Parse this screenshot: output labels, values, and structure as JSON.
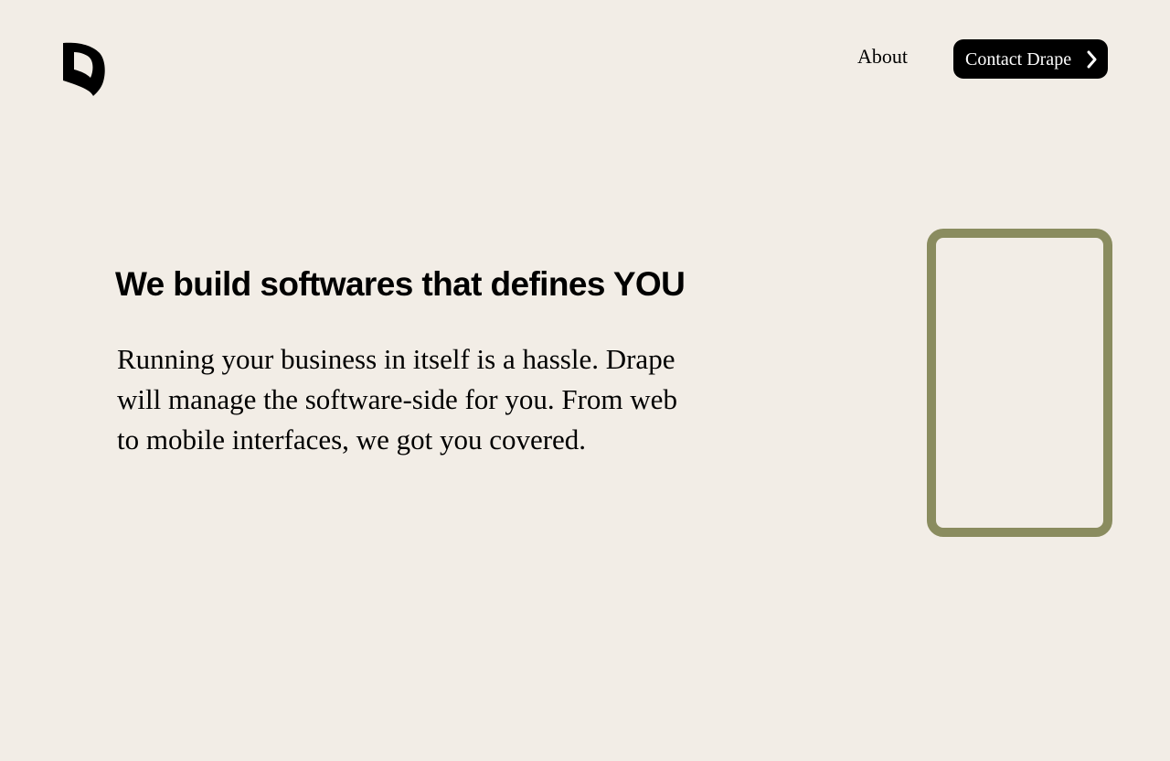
{
  "brand": {
    "logo_icon": "drape-leaf-logo-icon",
    "logo_color": "#000000"
  },
  "nav": {
    "about_label": "About",
    "contact_label": "Contact Drape",
    "contact_icon": "chevron-right-icon"
  },
  "hero": {
    "title": "We build softwares that defines YOU",
    "description": "Running your business in itself is a hassle. Drape will manage the software-side for you. From web to mobile interfaces, we got you covered."
  },
  "colors": {
    "background": "#f2ede6",
    "text": "#000000",
    "button_bg": "#000000",
    "button_text": "#ffffff",
    "device_frame": "#8a8c5f"
  }
}
